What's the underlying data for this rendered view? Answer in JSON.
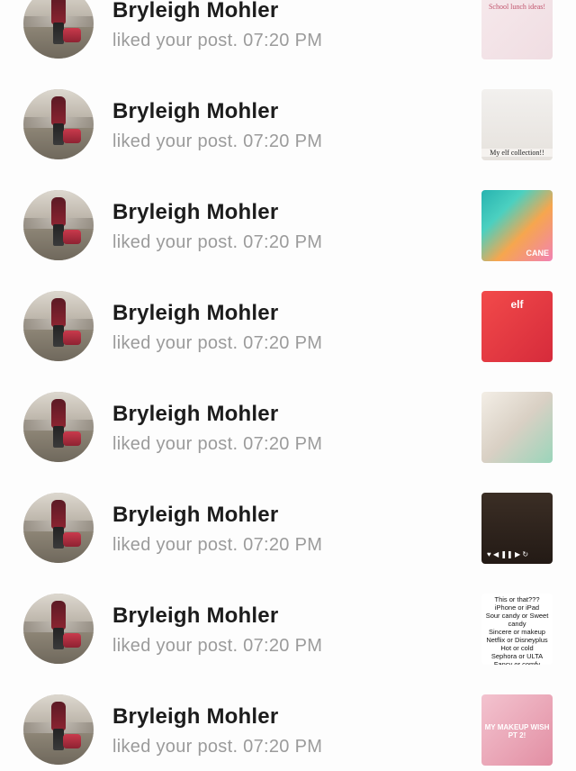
{
  "notifications": [
    {
      "name": "Bryleigh Mohler",
      "action": "liked your post.",
      "time": "07:20 PM",
      "thumb_text": "School lunch ideas!",
      "thumb_style": "t1"
    },
    {
      "name": "Bryleigh Mohler",
      "action": "liked your post.",
      "time": "07:20 PM",
      "thumb_text": "My elf collection!!",
      "thumb_style": "t2"
    },
    {
      "name": "Bryleigh Mohler",
      "action": "liked your post.",
      "time": "07:20 PM",
      "thumb_text": "CANE",
      "thumb_style": "t3"
    },
    {
      "name": "Bryleigh Mohler",
      "action": "liked your post.",
      "time": "07:20 PM",
      "thumb_text": "elf",
      "thumb_style": "t4"
    },
    {
      "name": "Bryleigh Mohler",
      "action": "liked your post.",
      "time": "07:20 PM",
      "thumb_text": "",
      "thumb_style": "t5"
    },
    {
      "name": "Bryleigh Mohler",
      "action": "liked your post.",
      "time": "07:20 PM",
      "thumb_text": "",
      "thumb_style": "t6"
    },
    {
      "name": "Bryleigh Mohler",
      "action": "liked your post.",
      "time": "07:20 PM",
      "thumb_text": "This or that???\niPhone or iPad\nSour candy or Sweet candy\nSincere or makeup\nNetflix or Disneyplus\nHot or cold\nSephora or ULTA\nFancy or comfy",
      "thumb_style": "t7"
    },
    {
      "name": "Bryleigh Mohler",
      "action": "liked your post.",
      "time": "07:20 PM",
      "thumb_text": "MY MAKEUP WISH PT 2!",
      "thumb_style": "t8"
    }
  ]
}
